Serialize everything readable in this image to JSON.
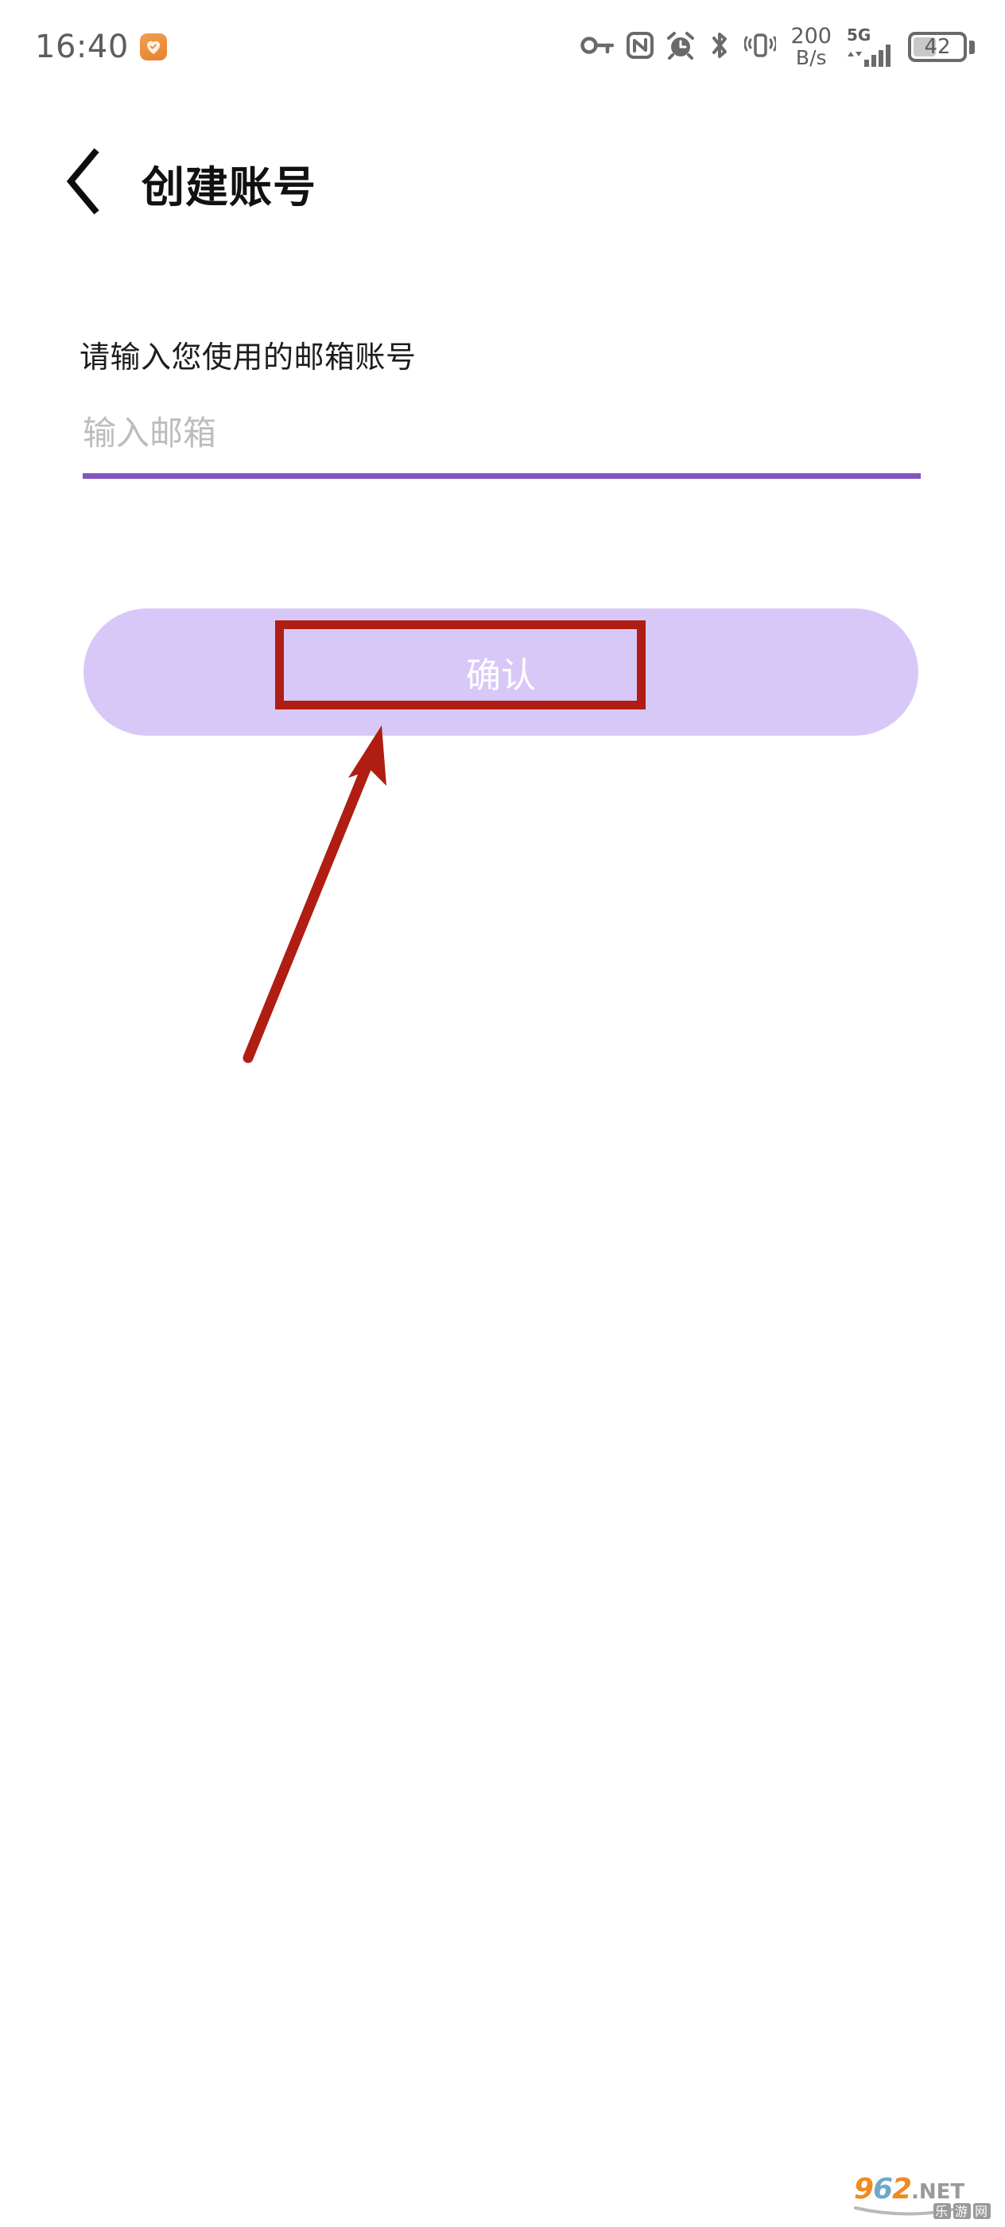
{
  "status_bar": {
    "time": "16:40",
    "app_badge_icon": "heart-check-icon",
    "icons": [
      {
        "name": "vpn-key-icon",
        "label": "VPN"
      },
      {
        "name": "nfc-icon",
        "label": "NFC"
      },
      {
        "name": "alarm-clock-icon",
        "label": "Alarm"
      },
      {
        "name": "bluetooth-icon",
        "label": "Bluetooth"
      },
      {
        "name": "vibrate-icon",
        "label": "Vibrate"
      }
    ],
    "network_speed": {
      "value": "200",
      "unit": "B/s"
    },
    "signal": {
      "network_type": "5G",
      "bars": 4
    },
    "battery": {
      "level_text": "42",
      "level_percent": 42
    }
  },
  "header": {
    "back_icon": "chevron-left-icon",
    "title": "创建账号"
  },
  "form": {
    "label": "请输入您使用的邮箱账号",
    "email_value": "",
    "email_placeholder": "输入邮箱",
    "underline_color": "#8155bd"
  },
  "confirm_button": {
    "label": "确认",
    "background_color": "#d8c8f7",
    "text_color": "#ffffff"
  },
  "annotations": {
    "highlight_color": "#b01d13",
    "rect_label": "confirm-button-highlight",
    "arrow_label": "pointer-arrow"
  },
  "watermark": {
    "primary": "962",
    "suffix": ".NET",
    "secondary": "乐游网",
    "orange": "#f08a1e",
    "blue": "#3a9fd8",
    "gray": "#8f8f8f"
  }
}
